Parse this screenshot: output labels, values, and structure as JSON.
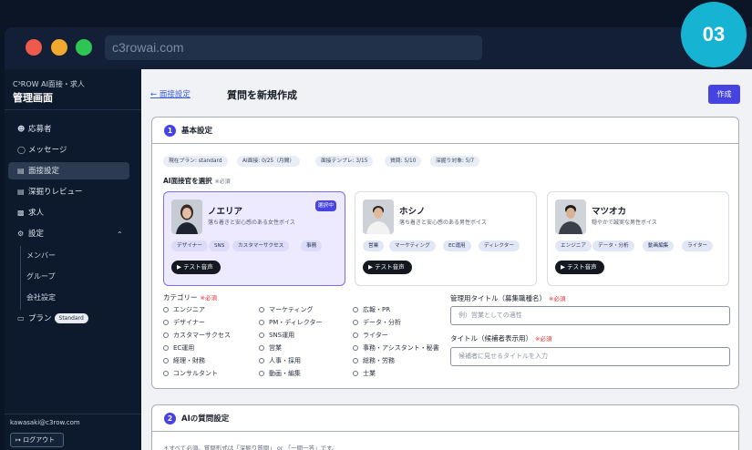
{
  "browser": {
    "url": "c3rowai.com",
    "step_badge": "03"
  },
  "sidebar": {
    "brand_sub": "C³ROW AI面接・求人",
    "brand_title": "管理画面",
    "items": [
      {
        "icon": "users-icon",
        "label": "応募者"
      },
      {
        "icon": "message-icon",
        "label": "メッセージ"
      },
      {
        "icon": "clipboard-icon",
        "label": "面接設定"
      },
      {
        "icon": "clipboard-icon",
        "label": "深掘りレビュー"
      },
      {
        "icon": "briefcase-icon",
        "label": "求人"
      },
      {
        "icon": "gear-icon",
        "label": "設定"
      }
    ],
    "sub_items": [
      "メンバー",
      "グループ",
      "会社設定"
    ],
    "plan_label": "プラン",
    "plan_badge": "Standard",
    "email": "kawasaki@c3row.com",
    "logout_label": "ログアウト"
  },
  "header": {
    "breadcrumb": "← 面接設定",
    "title": "質問を新規作成",
    "create_button": "作成"
  },
  "basic": {
    "number": "1",
    "title": "基本設定",
    "chips": [
      "現在プラン: standard",
      "AI面接: 0/25（月間）",
      "面接テンプレ: 3/15",
      "質問: 5/10",
      "深掘り対象: 5/7"
    ],
    "interviewer_label": "AI面接官を選択",
    "interviewer_req": "※必須",
    "interviewers": [
      {
        "name": "ノエリア",
        "desc": "落ち着きと安心感のある女性ボイス",
        "selected": true,
        "selected_label": "選択中",
        "tags": [
          "デザイナー",
          "SNS",
          "カスタマーサクセス",
          "事務"
        ],
        "test_label": "テスト音声"
      },
      {
        "name": "ホシノ",
        "desc": "落ち着きと安心感のある男性ボイス",
        "selected": false,
        "tags": [
          "営業",
          "マーケティング",
          "EC運用",
          "ディレクター"
        ],
        "test_label": "テスト音声"
      },
      {
        "name": "マツオカ",
        "desc": "穏やかで誠実な男性ボイス",
        "selected": false,
        "tags": [
          "エンジニア",
          "データ・分析",
          "動画編集",
          "ライター"
        ],
        "test_label": "テスト音声"
      }
    ],
    "category_label": "カテゴリー",
    "category_req": "※必須",
    "categories": [
      [
        "エンジニア",
        "デザイナー",
        "カスタマーサクセス",
        "EC運用",
        "経理・財務",
        "コンサルタント"
      ],
      [
        "マーケティング",
        "PM・ディレクター",
        "SNS運用",
        "営業",
        "人事・採用",
        "動画・編集"
      ],
      [
        "広報・PR",
        "データ・分析",
        "ライター",
        "事務・アシスタント・秘書",
        "総務・労務",
        "士業"
      ]
    ],
    "admin_title_label": "管理用タイトル（募集職種名）",
    "admin_title_req": "※必須",
    "admin_title_placeholder": "例）営業としての適性",
    "candidate_title_label": "タイトル（候補者表示用）",
    "candidate_title_req": "※必須",
    "candidate_title_placeholder": "候補者に見せるタイトルを入力"
  },
  "ai_questions": {
    "number": "2",
    "title": "AIの質問設定",
    "note": "＊すべて必須。質問形式は「深掘り質問」 or 「一問一答」です。"
  }
}
